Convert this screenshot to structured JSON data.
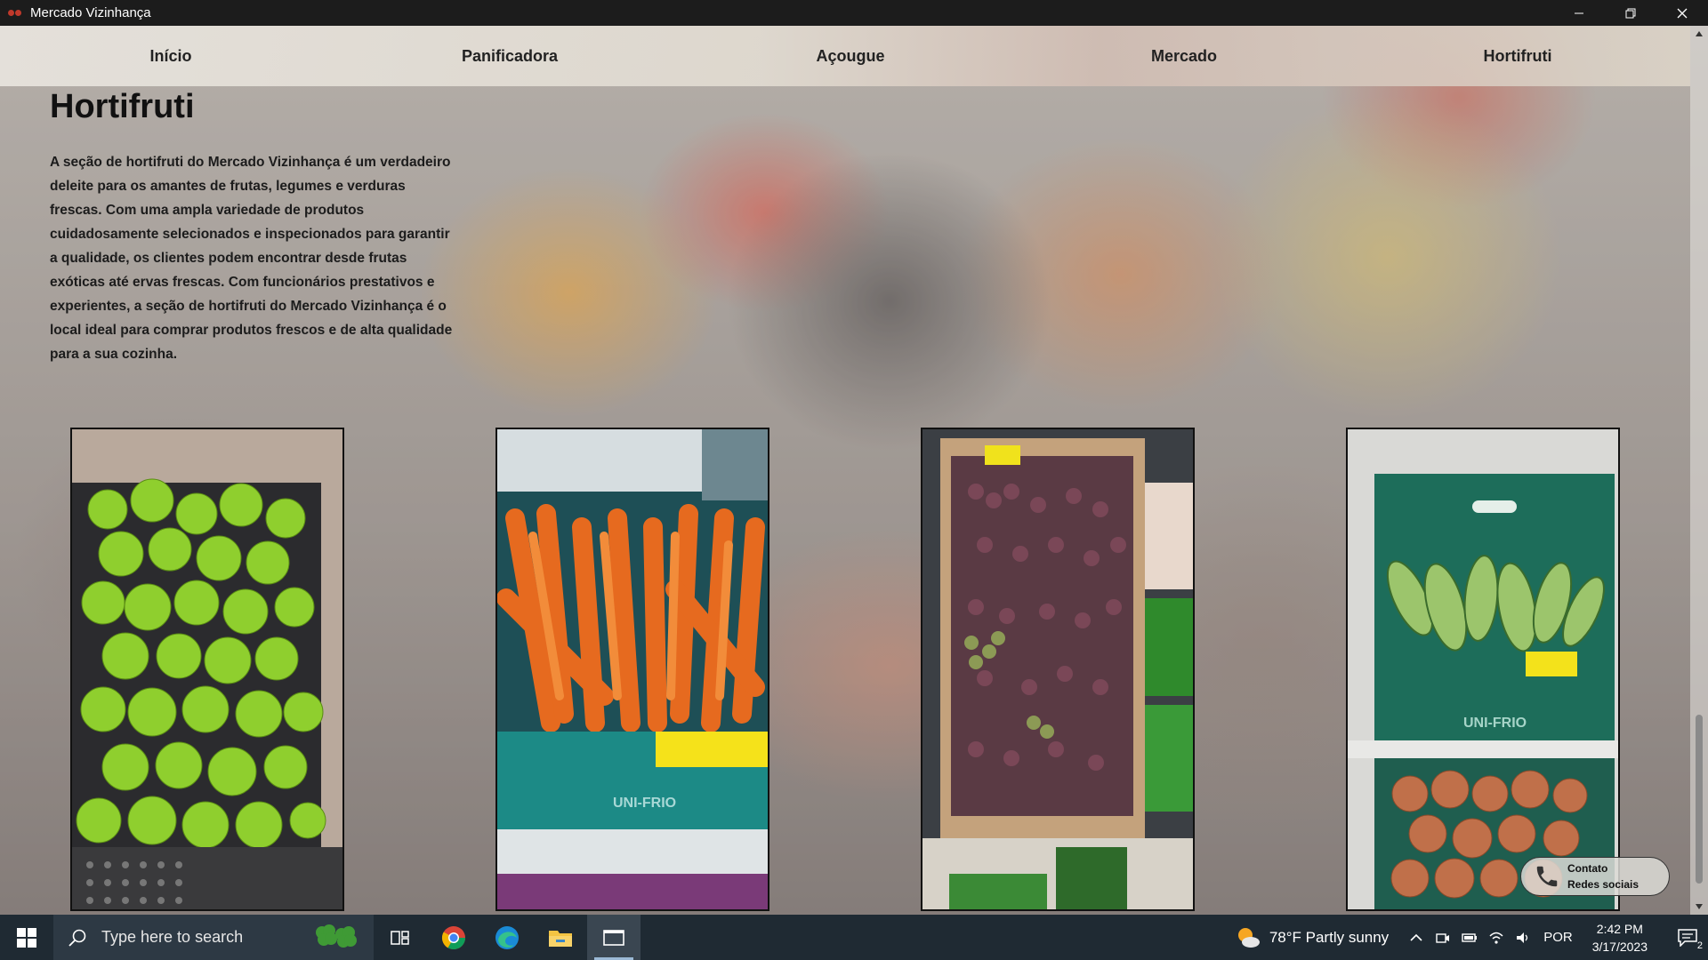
{
  "window": {
    "title": "Mercado Vizinhança",
    "controls": [
      "minimize-icon",
      "restore-icon",
      "close-icon"
    ]
  },
  "nav": {
    "items": [
      {
        "label": "Início"
      },
      {
        "label": "Panificadora"
      },
      {
        "label": "Açougue"
      },
      {
        "label": "Mercado"
      },
      {
        "label": "Hortifruti"
      }
    ]
  },
  "section": {
    "title": "Hortifruti",
    "description": "A seção de hortifruti do Mercado Vizinhança é um verdadeiro deleite para os amantes de frutas, legumes e verduras frescas. Com uma ampla variedade de produtos cuidadosamente selecionados e inspecionados para garantir a qualidade, os clientes podem encontrar desde frutas exóticas até ervas frescas. Com funcionários prestativos e experientes, a seção de hortifruti do Mercado Vizinhança é o local ideal para comprar produtos frescos e de alta qualidade para a sua cozinha."
  },
  "photos": [
    {
      "subject": "limes"
    },
    {
      "subject": "carrots"
    },
    {
      "subject": "grapes"
    },
    {
      "subject": "zucchini-and-onions"
    }
  ],
  "contact": {
    "line1": "Contato",
    "line2": "Redes sociais",
    "icon": "phone-icon"
  },
  "taskbar": {
    "search_placeholder": "Type here to search",
    "weather": "78°F  Partly sunny",
    "language": "POR",
    "time": "2:42 PM",
    "date": "3/17/2023",
    "notification_count": "2",
    "pinned": [
      "task-view-icon",
      "chrome-icon",
      "edge-icon",
      "file-explorer-icon",
      "app-window-icon"
    ]
  }
}
